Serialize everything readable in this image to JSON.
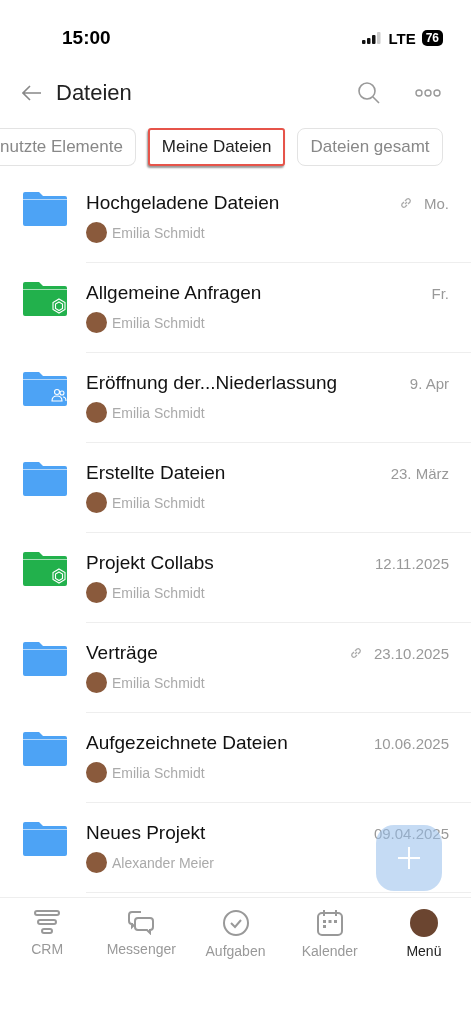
{
  "status_bar": {
    "time": "15:00",
    "network": "LTE",
    "battery": "76"
  },
  "header": {
    "title": "Dateien"
  },
  "chips": [
    {
      "label": "nutzte Elemente",
      "selected": false
    },
    {
      "label": "Meine Dateien",
      "selected": true
    },
    {
      "label": "Dateien gesamt",
      "selected": false
    }
  ],
  "files": [
    {
      "kind": "folder",
      "name": "Hochgeladene Dateien",
      "owner": "Emilia Schmidt",
      "date": "Mo.",
      "linked": true
    },
    {
      "kind": "group",
      "name": "Allgemeine Anfragen",
      "owner": "Emilia Schmidt",
      "date": "Fr.",
      "linked": false
    },
    {
      "kind": "shared",
      "name": "Eröffnung der...Niederlassung",
      "owner": "Emilia Schmidt",
      "date": "9. Apr",
      "linked": false
    },
    {
      "kind": "folder",
      "name": "Erstellte Dateien",
      "owner": "Emilia Schmidt",
      "date": "23. März",
      "linked": false
    },
    {
      "kind": "group",
      "name": "Projekt Collabs",
      "owner": "Emilia Schmidt",
      "date": "12.11.2025",
      "linked": false
    },
    {
      "kind": "folder",
      "name": "Verträge",
      "owner": "Emilia Schmidt",
      "date": "23.10.2025",
      "linked": true
    },
    {
      "kind": "folder",
      "name": "Aufgezeichnete Dateien",
      "owner": "Emilia Schmidt",
      "date": "10.06.2025",
      "linked": false
    },
    {
      "kind": "folder",
      "name": "Neues Projekt",
      "owner": "Alexander Meier",
      "date": "09.04.2025",
      "linked": false
    }
  ],
  "tab_bar": [
    {
      "kind": "crm",
      "label": "CRM",
      "selected": false
    },
    {
      "kind": "messenger",
      "label": "Messenger",
      "selected": false
    },
    {
      "kind": "tasks",
      "label": "Aufgaben",
      "selected": false
    },
    {
      "kind": "calendar",
      "label": "Kalender",
      "selected": false
    },
    {
      "kind": "avatar",
      "label": "Menü",
      "selected": true
    }
  ]
}
